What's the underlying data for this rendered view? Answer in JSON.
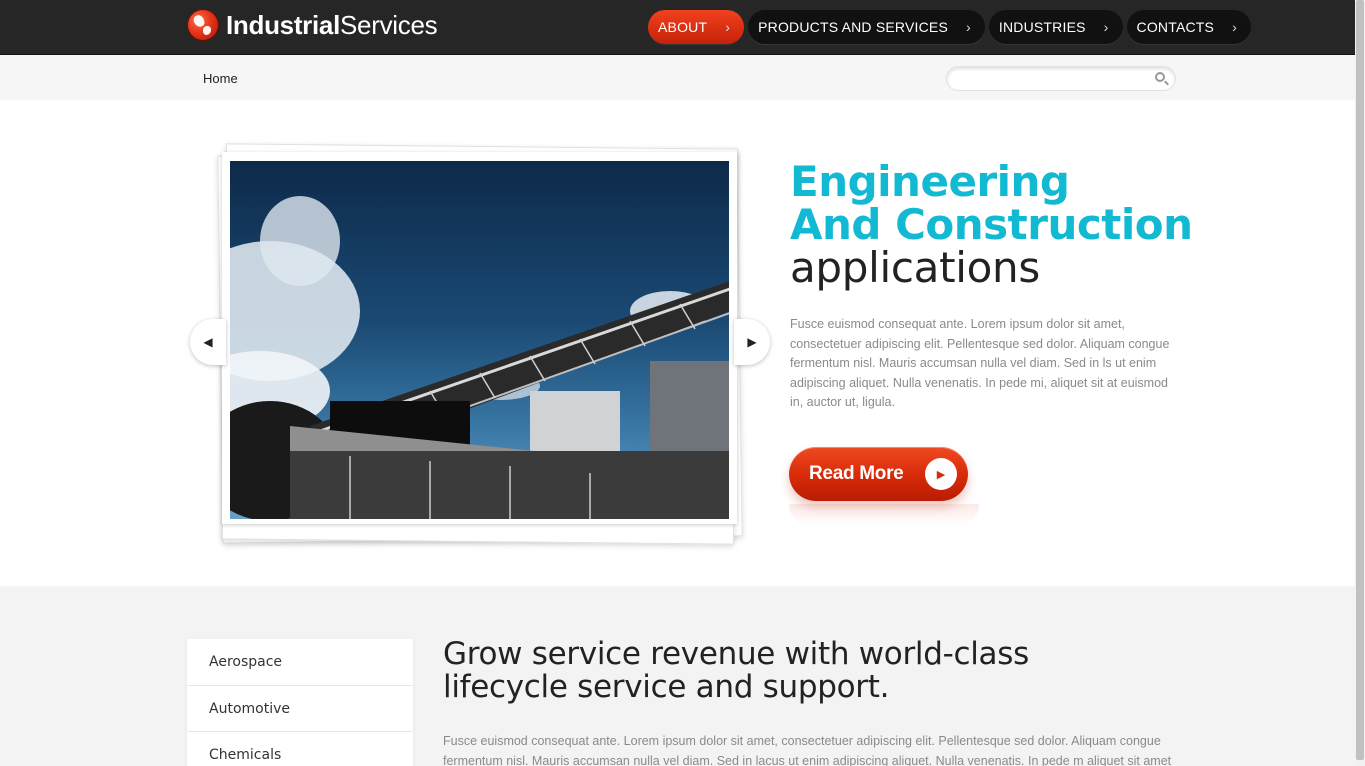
{
  "brand": {
    "bold": "Industrial",
    "light": "Services"
  },
  "nav": [
    {
      "label": "ABOUT",
      "active": true
    },
    {
      "label": "PRODUCTS AND SERVICES",
      "active": false
    },
    {
      "label": "INDUSTRIES",
      "active": false
    },
    {
      "label": "CONTACTS",
      "active": false
    }
  ],
  "breadcrumb": "Home",
  "search": {
    "placeholder": "",
    "value": ""
  },
  "slider": {
    "title_line1": "Engineering",
    "title_line2": "And Construction",
    "title_line3": "applications",
    "text": "Fusce euismod consequat ante. Lorem ipsum dolor sit amet, consectetuer adipiscing elit. Pellentesque sed dolor. Aliquam congue fermentum nisl. Mauris accumsan nulla vel diam. Sed in ls ut enim adipiscing aliquet. Nulla venenatis. In pede mi, aliquet sit at euismod in, auctor ut, ligula.",
    "button_label": "Read More"
  },
  "industries": [
    "Aerospace",
    "Automotive",
    "Chemicals"
  ],
  "content": {
    "title": "Grow service revenue with world-class lifecycle service and support.",
    "text": "Fusce euismod consequat ante. Lorem ipsum dolor sit amet, consectetuer adipiscing elit. Pellentesque sed dolor. Aliquam congue fermentum nisl. Mauris accumsan nulla vel diam. Sed in lacus ut enim adipiscing aliquet. Nulla venenatis. In pede m aliquet sit amet"
  },
  "colors": {
    "accent_red": "#d92c0a",
    "accent_cyan": "#12b9d2",
    "topbar": "#262626"
  }
}
